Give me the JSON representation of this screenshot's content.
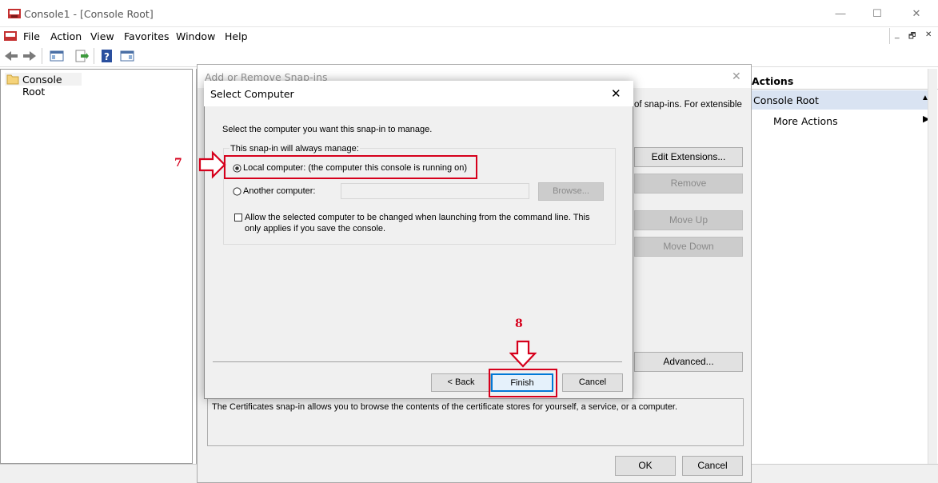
{
  "window": {
    "title": "Console1 - [Console Root]",
    "controls": {
      "minimize": "—",
      "maximize": "☐",
      "close": "✕"
    }
  },
  "menu": [
    "File",
    "Action",
    "View",
    "Favorites",
    "Window",
    "Help"
  ],
  "mdi_controls": [
    "_",
    "🗗",
    "✕"
  ],
  "tree": {
    "root": "Console Root"
  },
  "snapins_dialog": {
    "title": "Add or Remove Snap-ins",
    "close": "✕",
    "partial_text": "of snap-ins. For extensible",
    "buttons": {
      "edit_extensions": "Edit Extensions...",
      "remove": "Remove",
      "move_up": "Move Up",
      "move_down": "Move Down",
      "advanced": "Advanced...",
      "ok": "OK",
      "cancel": "Cancel"
    },
    "description": "The Certificates snap-in allows you to browse the contents of the certificate stores for yourself, a service, or a computer."
  },
  "select_computer": {
    "title": "Select Computer",
    "close": "✕",
    "instruction": "Select the computer you want this snap-in to manage.",
    "group_label": "This snap-in will always manage:",
    "local_option": "Local computer:  (the computer this console is running on)",
    "another_option": "Another computer:",
    "another_value": "",
    "browse": "Browse...",
    "allow_change": "Allow the selected computer to be changed when launching from the command line.  This only applies if you save the console.",
    "back": "< Back",
    "finish": "Finish",
    "cancel": "Cancel"
  },
  "actions": {
    "header": "Actions",
    "section": "Console Root",
    "more": "More Actions"
  },
  "annotations": {
    "step7": "7",
    "step8": "8"
  },
  "colors": {
    "annotation_red": "#d6001c",
    "selection_blue": "#cce4f7",
    "actions_header_bg": "#d9e3f2"
  }
}
